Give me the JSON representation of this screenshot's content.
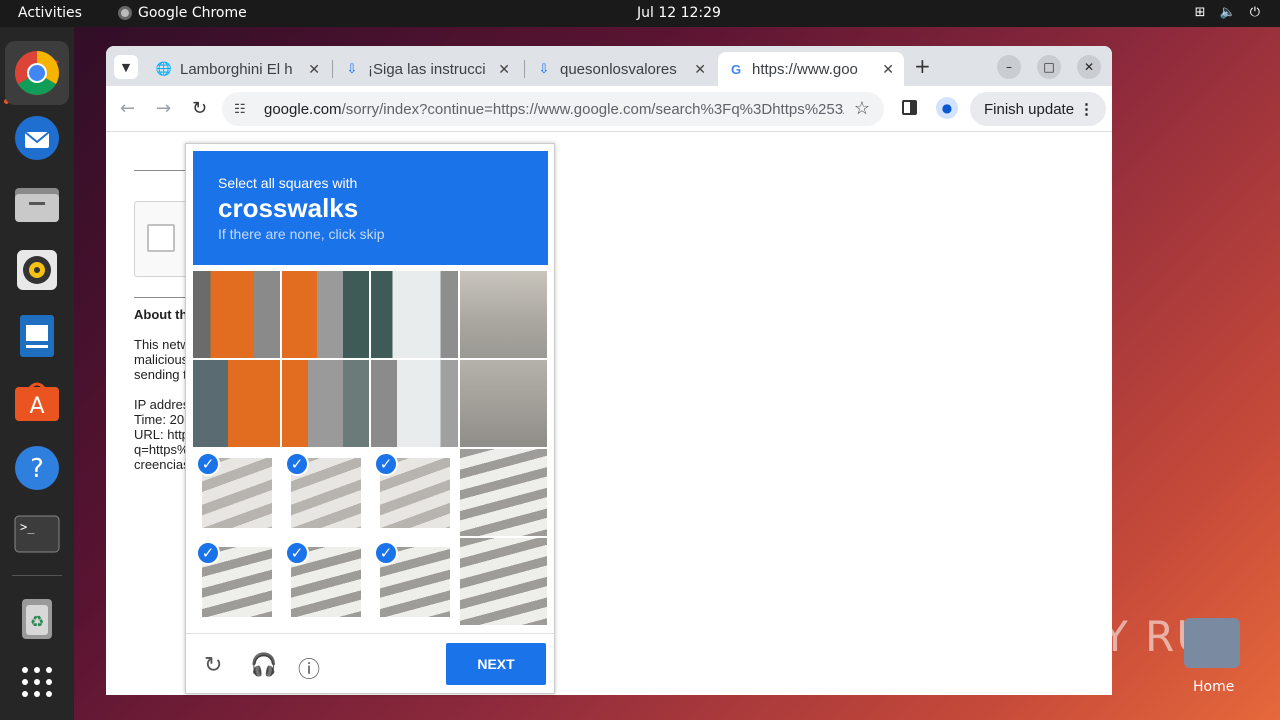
{
  "topbar": {
    "activities": "Activities",
    "app_name": "Google Chrome",
    "clock": "Jul 12  12:29"
  },
  "dock": [
    "chrome-icon",
    "thunderbird-icon",
    "files-icon",
    "rhythmbox-icon",
    "writer-icon",
    "software-icon",
    "help-icon",
    "terminal-icon",
    "trash-icon",
    "apps-grid-icon"
  ],
  "tabs": [
    {
      "title": "Lamborghini El h",
      "favicon": "globe-icon"
    },
    {
      "title": "¡Siga las instrucci",
      "favicon": "download-icon"
    },
    {
      "title": "quesonlosvalores",
      "favicon": "download-icon"
    },
    {
      "title": "https://www.goo",
      "favicon": "google-icon",
      "active": true
    }
  ],
  "omnibox": {
    "host": "google.com",
    "path": "/sorry/index?continue=https://www.google.com/search%3Fq%3Dhttps%253A..."
  },
  "finish_update": "Finish update",
  "page": {
    "about": "About th",
    "p1": [
      "This netw",
      "malicious",
      "sending t"
    ],
    "p2": [
      "IP addres",
      "Time: 20",
      "URL: http",
      "q=https%",
      "creencias"
    ]
  },
  "captcha": {
    "line1": "Select all squares with",
    "keyword": "crosswalks",
    "line3": "If there are none, click skip",
    "next": "NEXT"
  },
  "watermark": "ANY RUN",
  "home_label": "Home"
}
